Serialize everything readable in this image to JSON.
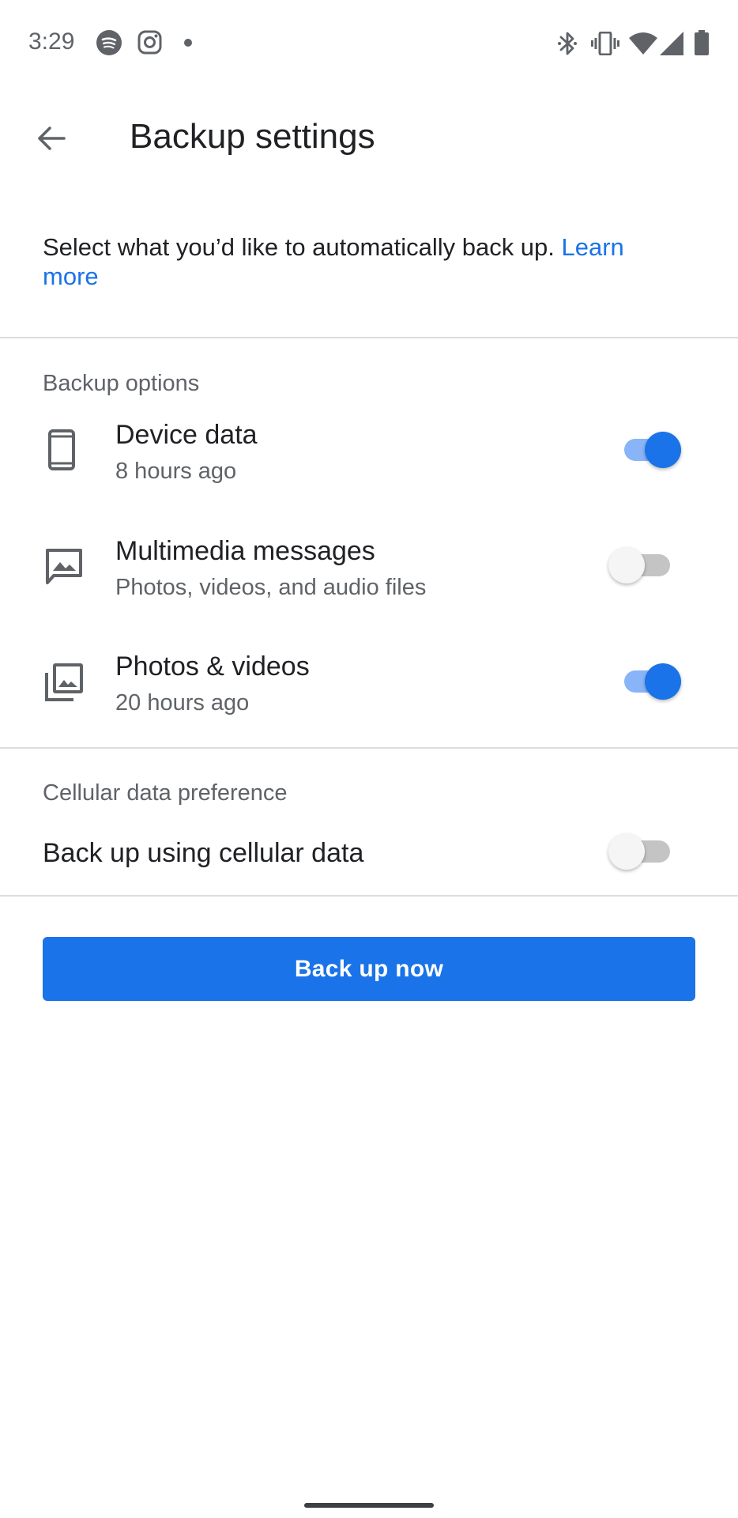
{
  "status_bar": {
    "time": "3:29",
    "left_icons": [
      "spotify-icon",
      "instagram-icon",
      "notification-dot-icon"
    ],
    "right_icons": [
      "bluetooth-icon",
      "vibrate-icon",
      "wifi-icon",
      "cellular-signal-icon",
      "battery-icon"
    ]
  },
  "app_bar": {
    "back_icon": "arrow-back-icon",
    "title": "Backup settings"
  },
  "intro": {
    "text": "Select what you’d like to automatically back up. ",
    "link": "Learn more"
  },
  "backup_options": {
    "header": "Backup options",
    "items": [
      {
        "icon": "phone-icon",
        "title": "Device data",
        "subtitle": "8 hours ago",
        "enabled": true
      },
      {
        "icon": "mms-icon",
        "title": "Multimedia messages",
        "subtitle": "Photos, videos, and audio files",
        "enabled": false
      },
      {
        "icon": "photo-library-icon",
        "title": "Photos & videos",
        "subtitle": "20 hours ago",
        "enabled": true
      }
    ]
  },
  "cellular": {
    "header": "Cellular data preference",
    "label": "Back up using cellular data",
    "enabled": false
  },
  "primary_button": {
    "label": "Back up now"
  },
  "colors": {
    "accent": "#1a73e8",
    "accent_light": "#8ab4f8",
    "text_primary": "#202124",
    "text_secondary": "#5f6368",
    "divider": "#dadce0"
  }
}
